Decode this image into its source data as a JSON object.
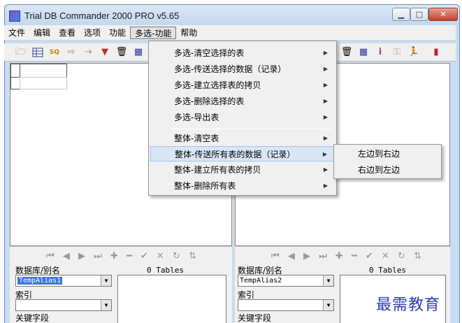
{
  "window": {
    "title": "Trial DB Commander 2000 PRO v5.65",
    "min_glyph": "▁",
    "max_glyph": "□",
    "close_glyph": "✕"
  },
  "menubar": {
    "items": [
      "文件",
      "编辑",
      "查看",
      "选项",
      "功能",
      "多选-功能",
      "帮助"
    ],
    "active_index": 5
  },
  "toolbar": {
    "icons": [
      "folder-open-icon",
      "table-icon",
      "sql-icon",
      "arrow-right-icon",
      "export-icon",
      "filter-icon",
      "delete-table-icon",
      "database-icon",
      "delete-table-icon",
      "database-icon",
      "info-icon",
      "key-icon",
      "run-icon",
      "exit-icon"
    ]
  },
  "dropdown": {
    "items": [
      {
        "label": "多选-清空选择的表"
      },
      {
        "label": "多选-传送选择的数据（记录）"
      },
      {
        "label": "多选-建立选择表的拷贝"
      },
      {
        "label": "多选-删除选择的表"
      },
      {
        "label": "多选-导出表"
      },
      {
        "label": "整体-清空表"
      },
      {
        "label": "整体-传送所有表的数据（记录）"
      },
      {
        "label": "整体-建立所有表的拷贝"
      },
      {
        "label": "整体-删除所有表"
      }
    ],
    "highlighted_index": 6,
    "chevron": "▶"
  },
  "submenu": {
    "items": [
      "左边到右边",
      "右边到左边"
    ]
  },
  "left_pane": {
    "nav_glyphs": "⏮ ◀ ▶ ⏭ ✚ ━ ✔ ✕ ↻ ⇅",
    "db_label": "数据库/别名",
    "tables_label": "0 Tables",
    "db_value": "TempAlias1",
    "index_label": "索引",
    "key_label": "关键字段"
  },
  "right_pane": {
    "nav_glyphs": "⏮ ◀ ▶ ⏭ ✚ ━ ✔ ✕ ↻ ⇅",
    "db_label": "数据库/别名",
    "tables_label": "0 Tables",
    "db_value": "TempAlias2",
    "index_label": "索引",
    "key_label": "关键字段"
  },
  "watermark": "最需教育",
  "colors": {
    "highlight": "#d9e6f5",
    "selection": "#3a75d7",
    "watermark": "#2a3fb0"
  }
}
